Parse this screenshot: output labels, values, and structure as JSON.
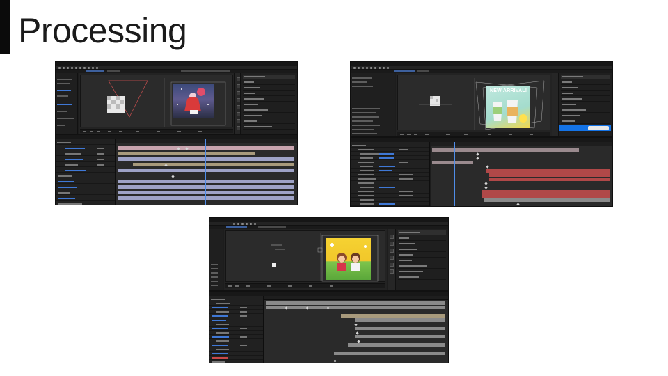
{
  "slide": {
    "title": "Processing"
  },
  "screenshots": [
    {
      "name": "after-effects-screenshot-1",
      "subject": "girl-with-balloon"
    },
    {
      "name": "after-effects-screenshot-2",
      "subject": "new-arrival-drink",
      "art_text": "NEW ARRIVAL!"
    },
    {
      "name": "after-effects-screenshot-3",
      "subject": "two-kids-park"
    }
  ],
  "colors": {
    "ui_bg": "#1d1d1d",
    "accent_blue": "#3f78d6",
    "layer_pink": "#c8a4ae",
    "layer_tan": "#a89a7c",
    "layer_lavender": "#9ea2c6",
    "layer_red": "#c24a4a",
    "layer_gray": "#8a8a8a"
  }
}
